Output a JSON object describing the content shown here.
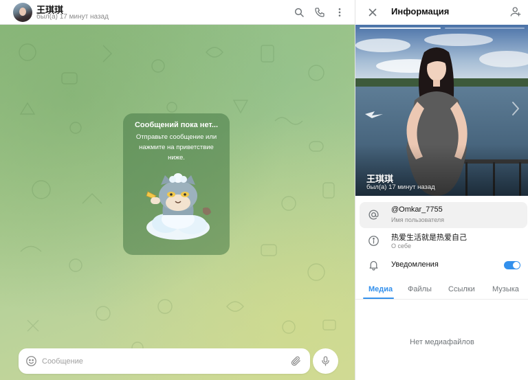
{
  "chat": {
    "name": "王琪琪",
    "status": "был(а) 17 минут назад",
    "empty_title": "Сообщений пока нет...",
    "empty_subtitle": "Отправьте сообщение или нажмите на приветствие ниже.",
    "composer_placeholder": "Сообщение"
  },
  "info": {
    "title": "Информация",
    "photo_name": "王琪琪",
    "photo_status": "был(а) 17 минут назад",
    "username_value": "@Omkar_7755",
    "username_label": "Имя пользователя",
    "bio_value": "热爱生活就是热爱自己",
    "bio_label": "О себе",
    "notifications_label": "Уведомления",
    "notifications_enabled": true,
    "tabs": [
      {
        "label": "Медиа",
        "active": true
      },
      {
        "label": "Файлы",
        "active": false
      },
      {
        "label": "Ссылки",
        "active": false
      },
      {
        "label": "Музыка",
        "active": false
      }
    ],
    "no_media": "Нет медиафайлов"
  },
  "colors": {
    "accent": "#3390ec",
    "muted_text": "#8a8a8a"
  },
  "icons": [
    "search-icon",
    "phone-icon",
    "more-vertical-icon",
    "close-icon",
    "add-contact-icon",
    "at-icon",
    "info-icon",
    "bell-icon",
    "emoji-icon",
    "paperclip-icon",
    "microphone-icon",
    "chevron-right-icon"
  ]
}
